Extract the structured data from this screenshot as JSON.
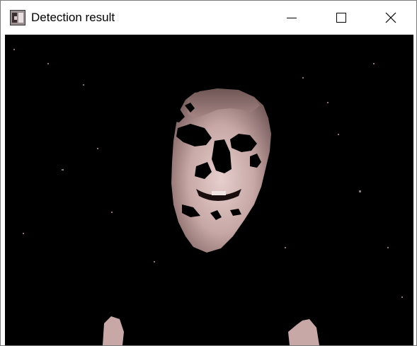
{
  "window": {
    "title": "Detection result",
    "app_icon": "image-window-icon",
    "controls": {
      "minimize_icon": "minimize-icon",
      "maximize_icon": "maximize-icon",
      "close_icon": "close-icon"
    }
  },
  "content": {
    "image_subject": "skin-detection-mask-face",
    "background_color": "#000000",
    "skin_color": "#c4a6a4"
  }
}
